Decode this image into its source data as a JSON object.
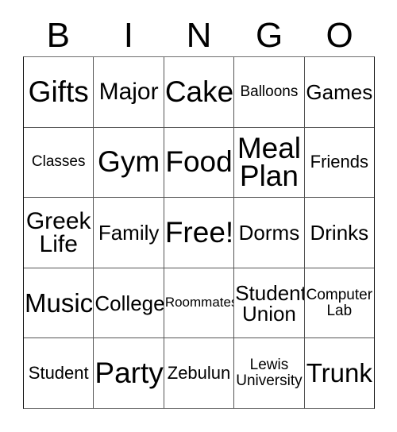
{
  "card": {
    "title_letters": [
      "B",
      "I",
      "N",
      "G",
      "O"
    ],
    "columns": 5,
    "rows": 5,
    "free_space_label": "Free!",
    "colors": {
      "text": "#000000",
      "background": "#ffffff",
      "grid_line": "#555555",
      "grid_border": "#111111"
    },
    "grid": [
      [
        {
          "label": "Gifts",
          "size": "xxl"
        },
        {
          "label": "Major",
          "size": "l"
        },
        {
          "label": "Cake",
          "size": "xxl"
        },
        {
          "label": "Balloons",
          "size": "xs"
        },
        {
          "label": "Games",
          "size": "m"
        }
      ],
      [
        {
          "label": "Classes",
          "size": "xs"
        },
        {
          "label": "Gym",
          "size": "xxl"
        },
        {
          "label": "Food",
          "size": "xxl"
        },
        {
          "label": "Meal\nPlan",
          "size": "xxl"
        },
        {
          "label": "Friends",
          "size": "s"
        }
      ],
      [
        {
          "label": "Greek\nLife",
          "size": "l"
        },
        {
          "label": "Family",
          "size": "m"
        },
        {
          "label": "Free!",
          "size": "xxl"
        },
        {
          "label": "Dorms",
          "size": "m"
        },
        {
          "label": "Drinks",
          "size": "m"
        }
      ],
      [
        {
          "label": "Music",
          "size": "xl"
        },
        {
          "label": "College",
          "size": "m"
        },
        {
          "label": "Roommates",
          "size": "xxs"
        },
        {
          "label": "Student\nUnion",
          "size": "m"
        },
        {
          "label": "Computer\nLab",
          "size": "xs"
        }
      ],
      [
        {
          "label": "Student",
          "size": "s"
        },
        {
          "label": "Party",
          "size": "xxl"
        },
        {
          "label": "Zebulun",
          "size": "s"
        },
        {
          "label": "Lewis\nUniversity",
          "size": "xs"
        },
        {
          "label": "Trunk",
          "size": "xl"
        }
      ]
    ]
  }
}
